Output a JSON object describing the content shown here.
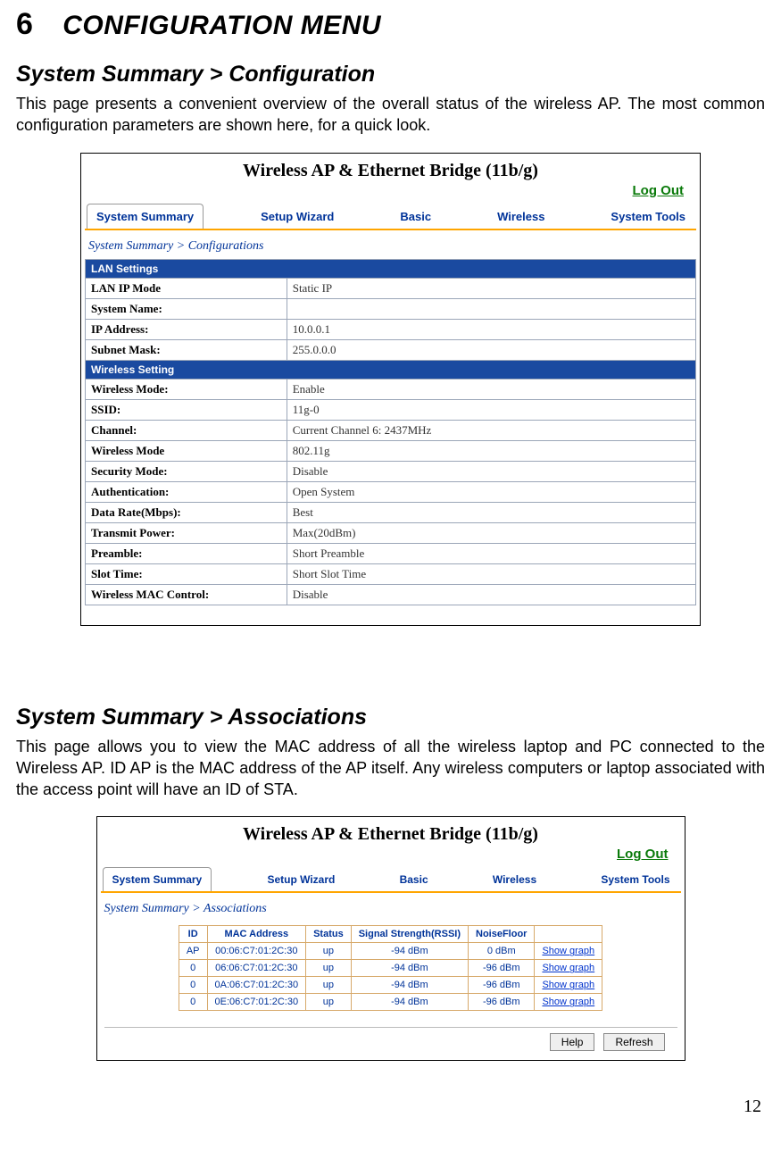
{
  "chapter": {
    "num": "6",
    "title": "CONFIGURATION MENU"
  },
  "sec1": {
    "title": "System Summary > Configuration",
    "para": "This page presents a convenient overview of the overall status of the wireless AP. The most common configuration parameters are shown here, for a quick look."
  },
  "sec2": {
    "title": "System Summary > Associations",
    "para": "This page allows you to view the MAC address of all the wireless laptop and PC connected to the Wireless AP. ID AP is the MAC address of the AP itself. Any wireless computers or laptop associated with the access point will have an ID of STA."
  },
  "app": {
    "title": "Wireless AP & Ethernet Bridge (11b/g)",
    "logout": "Log Out",
    "tabs": [
      "System Summary",
      "Setup Wizard",
      "Basic",
      "Wireless",
      "System Tools"
    ]
  },
  "config": {
    "breadcrumb": "System Summary > Configurations",
    "lan_header": "LAN Settings",
    "lan_rows": [
      {
        "label": "LAN IP Mode",
        "value": "Static IP"
      },
      {
        "label": "System Name:",
        "value": ""
      },
      {
        "label": "IP Address:",
        "value": "10.0.0.1"
      },
      {
        "label": "Subnet Mask:",
        "value": "255.0.0.0"
      }
    ],
    "wifi_header": "Wireless Setting",
    "wifi_rows": [
      {
        "label": "Wireless Mode:",
        "value": "Enable"
      },
      {
        "label": "SSID:",
        "value": "11g-0"
      },
      {
        "label": "Channel:",
        "value": "Current Channel 6: 2437MHz"
      },
      {
        "label": "Wireless Mode",
        "value": "802.11g"
      },
      {
        "label": "Security Mode:",
        "value": "Disable"
      },
      {
        "label": "Authentication:",
        "value": "Open System"
      },
      {
        "label": "Data Rate(Mbps):",
        "value": "Best"
      },
      {
        "label": "Transmit Power:",
        "value": "Max(20dBm)"
      },
      {
        "label": "Preamble:",
        "value": "Short Preamble"
      },
      {
        "label": "Slot Time:",
        "value": "Short Slot Time"
      },
      {
        "label": "Wireless MAC Control:",
        "value": "Disable"
      }
    ]
  },
  "assoc": {
    "breadcrumb": "System Summary > Associations",
    "columns": [
      "ID",
      "MAC Address",
      "Status",
      "Signal Strength(RSSI)",
      "NoiseFloor",
      ""
    ],
    "rows": [
      {
        "id": "AP",
        "mac": "00:06:C7:01:2C:30",
        "status": "up",
        "rssi": "-94 dBm",
        "noise": "0  dBm",
        "link": "Show graph"
      },
      {
        "id": "0",
        "mac": "06:06:C7:01:2C:30",
        "status": "up",
        "rssi": "-94 dBm",
        "noise": "-96  dBm",
        "link": "Show graph"
      },
      {
        "id": "0",
        "mac": "0A:06:C7:01:2C:30",
        "status": "up",
        "rssi": "-94 dBm",
        "noise": "-96  dBm",
        "link": "Show graph"
      },
      {
        "id": "0",
        "mac": "0E:06:C7:01:2C:30",
        "status": "up",
        "rssi": "-94 dBm",
        "noise": "-96  dBm",
        "link": "Show graph"
      }
    ],
    "buttons": {
      "help": "Help",
      "refresh": "Refresh"
    }
  },
  "pagenum": "12"
}
